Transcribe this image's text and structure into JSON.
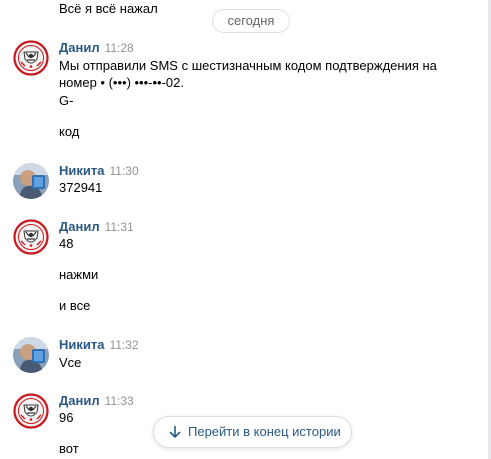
{
  "previous_message": {
    "text": "Всё я всё нажал"
  },
  "date_divider": {
    "label": "сегодня"
  },
  "messages": [
    {
      "author": "Данил",
      "time": "11:28",
      "avatar_icon": "crest-logo-avatar",
      "lines": [
        "Мы отправили SMS с шестизначным кодом подтверждения на",
        "номер • (•••) •••-••-02.",
        "G-",
        "код"
      ]
    },
    {
      "author": "Никита",
      "time": "11:30",
      "avatar_icon": "photo-avatar",
      "lines": [
        "372941"
      ]
    },
    {
      "author": "Данил",
      "time": "11:31",
      "avatar_icon": "crest-logo-avatar",
      "lines": [
        "48",
        "нажми",
        "и все"
      ]
    },
    {
      "author": "Никита",
      "time": "11:32",
      "avatar_icon": "photo-avatar",
      "lines": [
        "Vce"
      ]
    },
    {
      "author": "Данил",
      "time": "11:33",
      "avatar_icon": "crest-logo-avatar",
      "lines": [
        "96",
        "вот"
      ]
    }
  ],
  "scroll_to_end": {
    "label": "Перейти в конец истории",
    "icon": "arrow-down-icon"
  },
  "colors": {
    "author": "#2a5885",
    "time": "#939393",
    "pill_border": "#dce1e6",
    "pill_text": "#656565",
    "crest_red": "#c8191f"
  }
}
